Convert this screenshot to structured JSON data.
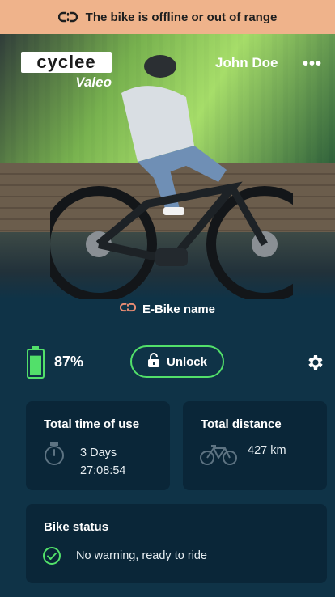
{
  "banner": {
    "icon": "link-broken-icon",
    "text": "The bike is offline or out of range",
    "color": "#efb38b"
  },
  "header": {
    "logo_brand": "cyclee",
    "logo_sub": "Valeo",
    "user_name": "John Doe",
    "more_label": "•••"
  },
  "bike": {
    "icon": "link-broken-icon",
    "name": "E-Bike name"
  },
  "controls": {
    "battery_percent": "87%",
    "battery_level": 0.87,
    "unlock_label": "Unlock",
    "accent_color": "#52e06a"
  },
  "stats": {
    "time": {
      "title": "Total time of use",
      "days": "3 Days",
      "clock": "27:08:54",
      "icon": "stopwatch-icon"
    },
    "distance": {
      "title": "Total distance",
      "value": "427 km",
      "icon": "bike-icon"
    }
  },
  "bike_status": {
    "title": "Bike status",
    "message": "No warning, ready to ride",
    "icon": "check-circle-icon"
  }
}
